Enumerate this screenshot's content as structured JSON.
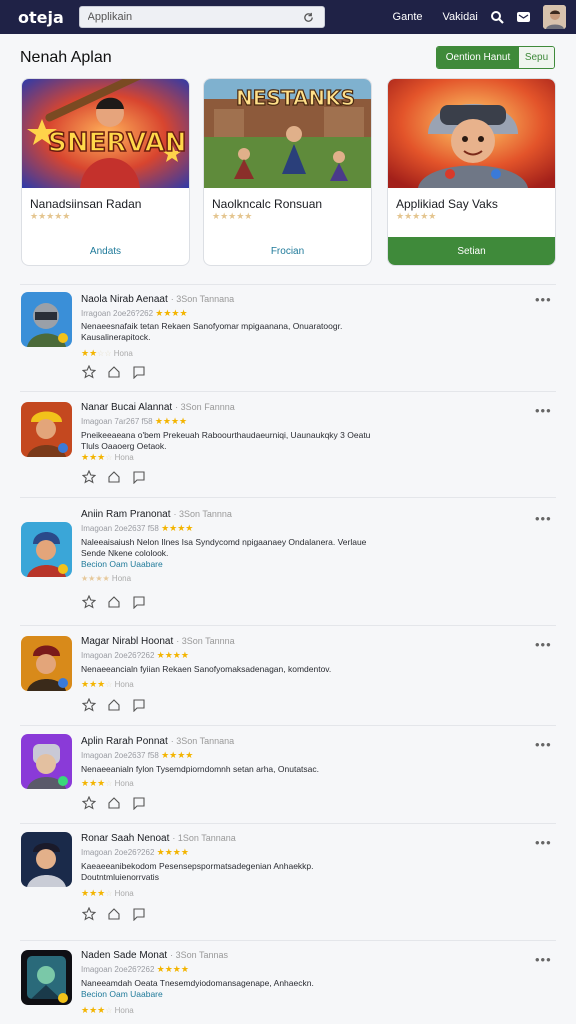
{
  "topbar": {
    "logo": "oteja",
    "search_placeholder": "Applikain",
    "nav": [
      "Gante",
      "Vakidai"
    ]
  },
  "section": {
    "title": "Nenah Aplan",
    "segment": [
      "Oention Hanut",
      "Sepu"
    ]
  },
  "featured": [
    {
      "name": "Nanadsiinsan Radan",
      "cta": "Andats",
      "stars": "★★★★★"
    },
    {
      "name": "Naolkncalc Ronsuan",
      "cta": "Frocian",
      "stars": "★★★★★"
    },
    {
      "name": "Applikiad Say Vaks",
      "cta": "Setian",
      "stars": "★★★★★"
    }
  ],
  "list": [
    {
      "title": "Naola Nirab Aenaat",
      "tag": "· 3Son  Tannana",
      "meta": "Irragoan 2oe26?262",
      "desc": "Nenaeesnafaik tetan Rekaen Sanofyomar mpigaanana, Onuaratoogr. Kausalinerapitock.",
      "link": "",
      "r2": "Hona"
    },
    {
      "title": "Nanar Bucai Alannat",
      "tag": "· 3Son  Fannna",
      "meta": "Imagoan 7ar267 f58",
      "desc": "Pneikeeaeana o'bem Prekeuah Raboourthaudaeurniqi, Uaunaukqky 3 Oeatu Tluls Oaaoerg Oetaok.",
      "link": "",
      "r2": "Hona"
    },
    {
      "title": "Aniin Ram Pranonat",
      "tag": "· 3Son  Tannna",
      "meta": "Imagoan 2oe2637 f58",
      "desc": "Naleeaisaiush Nelon Ilnes Isa Syndycomd npigaanaey Ondalanera. Verlaue Sende Nkene cololook.",
      "link": "Becion Oam Uaabare",
      "r2": "Hona"
    },
    {
      "title": "Magar Nirabl Hoonat",
      "tag": "· 3Son  Tannna",
      "meta": "Imagoan 2oe26?262",
      "desc": "Nenaeeancialn fyiian Rekaen Sanofyomaksadenagan, komdentov.",
      "link": "",
      "r2": "Hona"
    },
    {
      "title": "Aplin Rarah Ponnat",
      "tag": "· 3Son  Tannana",
      "meta": "Imagoan 2oe2637 f58",
      "desc": "Nenaeeanialn fylon Tysemdpiorndomnh setan arha, Onutatsac.",
      "link": "",
      "r2": "Hona"
    },
    {
      "title": "Ronar Saah Nenoat",
      "tag": "· 1Son  Tannana",
      "meta": "Imagoan 2oe26?262",
      "desc": "Kaeaeeanibekodom Pesensepspormatsadegenian Anhaekkp. Doutntmluienorrvatis",
      "link": "",
      "r2": "Hona"
    },
    {
      "title": "Naden Sade Monat",
      "tag": "· 3Son  Tannas",
      "meta": "Imagoan 2oe26?262",
      "desc": "Naneeamdah Oeata Tnesemdyiodomansagenape, Anhaeckn.",
      "link": "Becion Oam Uaabare",
      "r2": "Hona"
    }
  ],
  "colors": {
    "topbar": "#1f2246",
    "accent_green": "#3f8a3a",
    "link": "#1f7a9a",
    "star": "#f3b400"
  }
}
